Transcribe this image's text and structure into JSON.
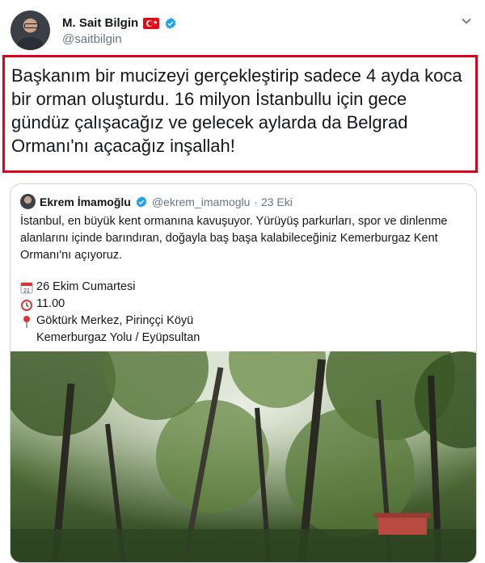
{
  "tweet": {
    "display_name": "M. Sait Bilgin",
    "handle": "@saitbilgin",
    "text": "Başkanım bir mucizeyi gerçekleştirip sadece 4 ayda koca bir orman oluşturdu. 16 milyon İstanbullu için gece gündüz çalışacağız ve gelecek aylarda da Belgrad Ormanı'nı açacağız inşallah!"
  },
  "quoted": {
    "display_name": "Ekrem İmamoğlu",
    "handle": "@ekrem_imamoglu",
    "time": "· 23 Eki",
    "text": "İstanbul, en büyük kent ormanına kavuşuyor. Yürüyüş parkurları, spor ve dinlenme alanlarını içinde barındıran, doğayla baş başa kalabileceğiniz Kemerburgaz Kent Ormanı'nı açıyoruz.",
    "date_line": "26 Ekim Cumartesi",
    "time_line": "11.00",
    "location_line1": "Göktürk Merkez, Pirinççi Köyü",
    "location_line2": "Kemerburgaz Yolu / Eyüpsultan",
    "calendar_icon_text": "21"
  },
  "icons": {
    "flag": "turkey-flag-icon",
    "verified": "verified-badge-icon",
    "more": "chevron-down-icon",
    "calendar": "calendar-icon",
    "clock": "alarm-clock-icon",
    "pin": "location-pin-icon"
  },
  "colors": {
    "highlight_border": "#e0001b",
    "verified_blue": "#1da1f2",
    "secondary_text": "#657786"
  }
}
